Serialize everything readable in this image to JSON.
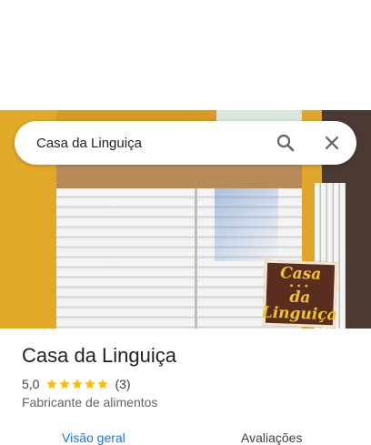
{
  "search": {
    "query": "Casa da Linguiça",
    "search_icon": "search-icon",
    "close_icon": "close-icon"
  },
  "photo": {
    "sign_lines": [
      "Casa",
      "da",
      "Linguiça"
    ]
  },
  "place": {
    "name": "Casa da Linguiça",
    "rating": "5,0",
    "stars": 5,
    "review_count": "(3)",
    "category": "Fabricante de alimentos"
  },
  "tabs": [
    {
      "label": "Visão geral",
      "active": true
    },
    {
      "label": "Avaliações",
      "active": false
    }
  ],
  "colors": {
    "accent": "#1a73e8",
    "star": "#fbbc04",
    "text": "#202124",
    "secondary_text": "#5f6368"
  }
}
